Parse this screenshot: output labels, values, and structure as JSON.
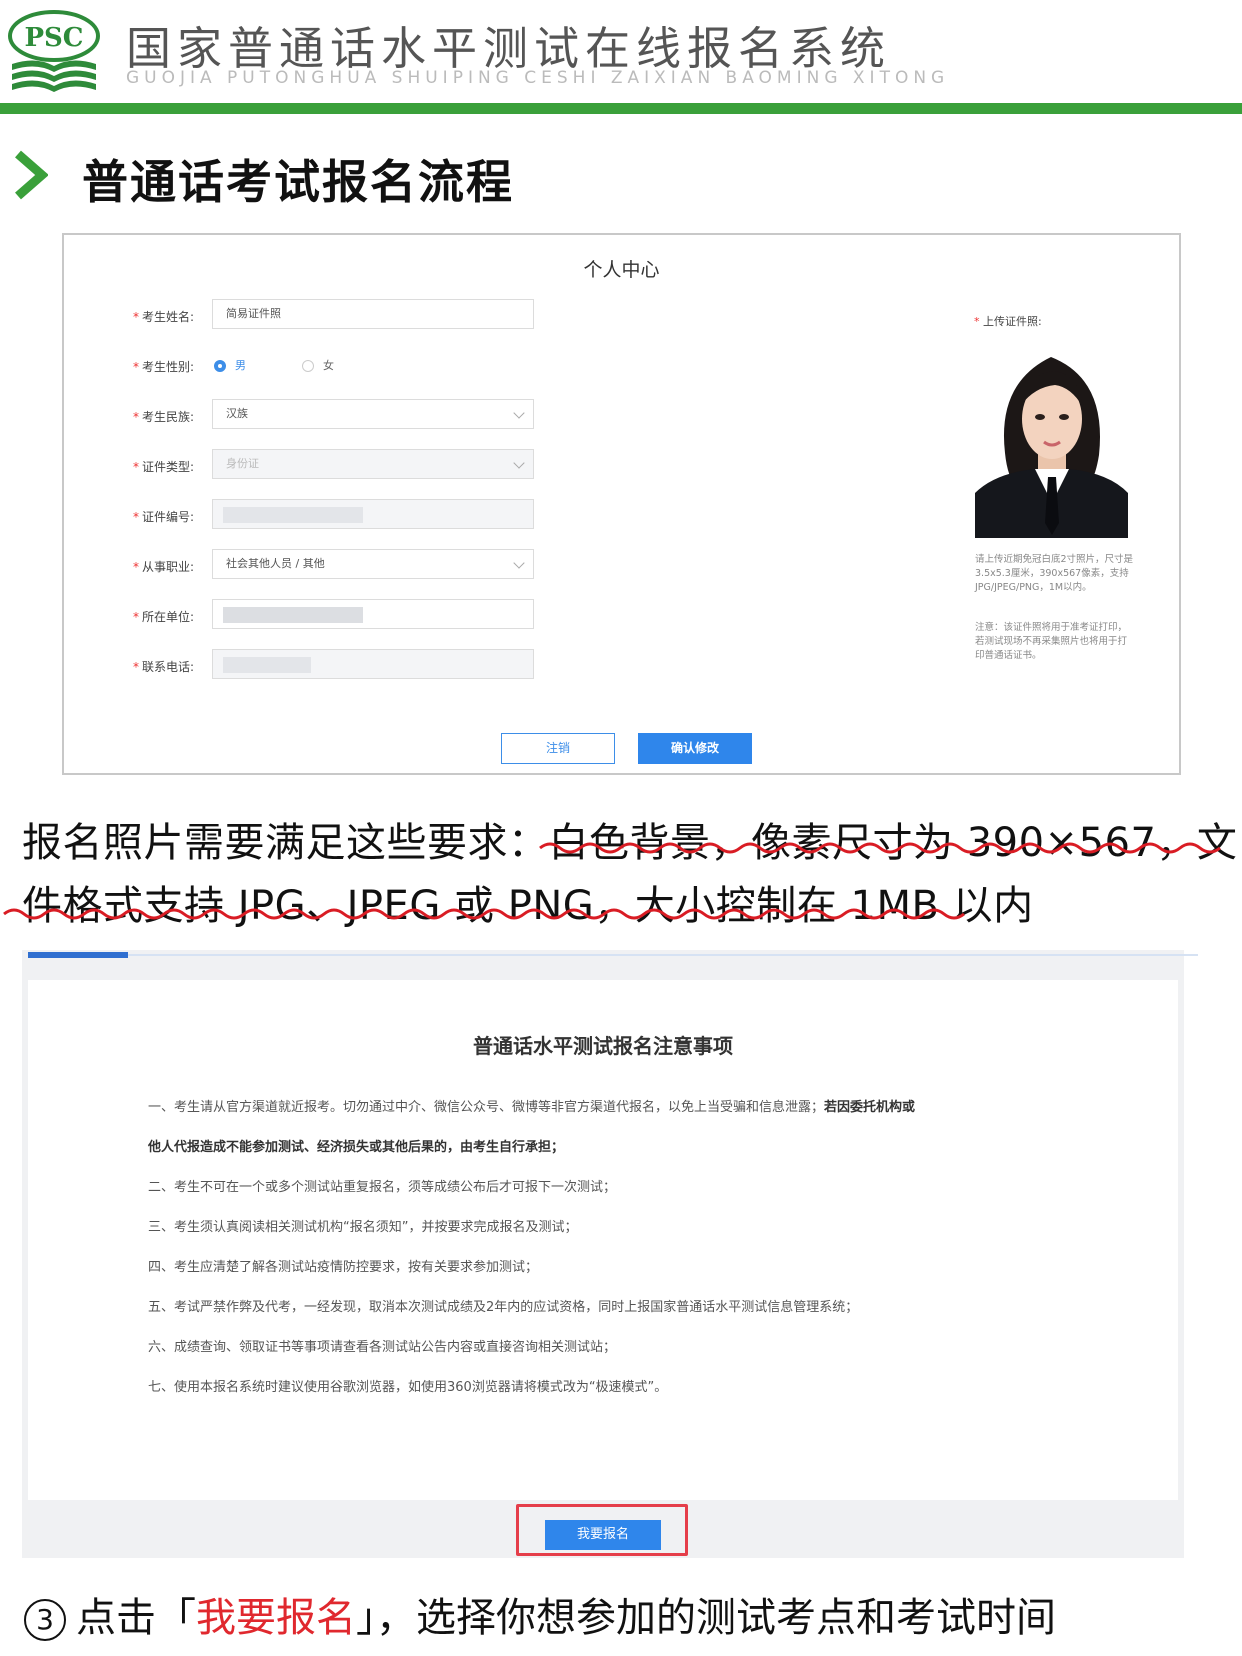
{
  "header": {
    "logo_text": "PSC",
    "title": "国家普通话水平测试在线报名系统",
    "pinyin": "GUOJIA PUTONGHUA SHUIPING CESHI ZAIXIAN BAOMING XITONG",
    "accent_color": "#3aa03a"
  },
  "section": {
    "title": "普通话考试报名流程",
    "icon": "chevron-right-icon"
  },
  "profile": {
    "title": "个人中心",
    "fields": [
      {
        "label": "考生姓名:",
        "value": "简易证件照"
      },
      {
        "label": "考生性别:",
        "options": [
          "男",
          "女"
        ],
        "selected": "男"
      },
      {
        "label": "考生民族:",
        "value": "汉族"
      },
      {
        "label": "证件类型:",
        "value": "身份证"
      },
      {
        "label": "证件编号:",
        "value": ""
      },
      {
        "label": "从事职业:",
        "value": "社会其他人员 / 其他"
      },
      {
        "label": "所在单位:",
        "value": ""
      },
      {
        "label": "联系电话:",
        "value": ""
      }
    ],
    "photo_label": "上传证件照:",
    "photo_note1": "请上传近期免冠白底2寸照片，尺寸是3.5x5.3厘米，390x567像素，支持JPG/JPEG/PNG，1M以内。",
    "photo_note2": "注意：该证件照将用于准考证打印，若测试现场不再采集照片也将用于打印普通话证书。",
    "cancel_label": "注销",
    "confirm_label": "确认修改"
  },
  "requirement": {
    "line1": "报名照片需要满足这些要求：白色背景，像素尺寸为 390×567，文",
    "line2": "件格式支持 JPG、JPEG 或 PNG，大小控制在 1MB 以内"
  },
  "notice": {
    "title": "普通话水平测试报名注意事项",
    "item1_a": "一、考生请从官方渠道就近报考。切勿通过中介、微信公众号、微博等非官方渠道代报名，以免上当受骗和信息泄露；",
    "item1_b": "若因委托机构或",
    "item1_c": "他人代报造成不能参加测试、经济损失或其他后果的，由考生自行承担；",
    "items": [
      "二、考生不可在一个或多个测试站重复报名，须等成绩公布后才可报下一次测试；",
      "三、考生须认真阅读相关测试机构“报名须知”，并按要求完成报名及测试；",
      "四、考生应清楚了解各测试站疫情防控要求，按有关要求参加测试；",
      "五、考试严禁作弊及代考，一经发现，取消本次测试成绩及2年内的应试资格，同时上报国家普通话水平测试信息管理系统；",
      "六、成绩查询、领取证书等事项请查看各测试站公告内容或直接咨询相关测试站；",
      "七、使用本报名系统时建议使用谷歌浏览器，如使用360浏览器请将模式改为“极速模式”。"
    ],
    "signup_label": "我要报名"
  },
  "step3": {
    "num": "③",
    "pre": "点击「",
    "highlight": "我要报名",
    "post": "」，选择你想参加的测试考点和考试时间"
  }
}
